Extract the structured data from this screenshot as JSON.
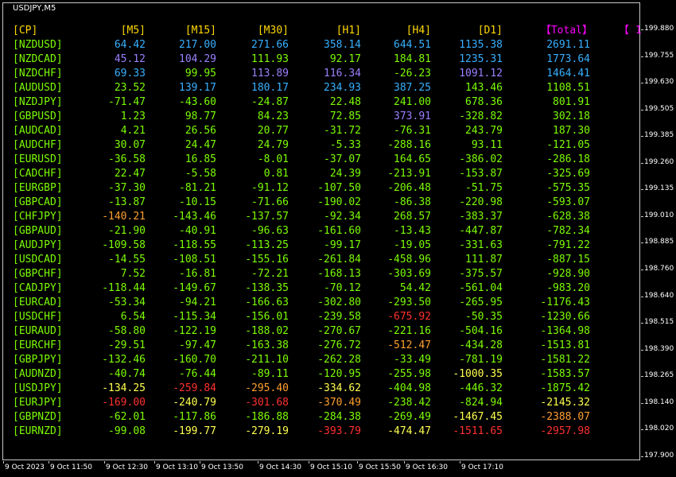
{
  "chart_title": "USDJPY,M5",
  "price_axis": [
    "199.880",
    "199.755",
    "199.630",
    "199.505",
    "199.385",
    "199.260",
    "199.135",
    "199.010",
    "198.885",
    "198.760",
    "198.640",
    "198.515",
    "198.390",
    "198.265",
    "198.140",
    "198.020",
    "197.900"
  ],
  "time_axis": [
    "9 Oct 2023",
    "9 Oct 11:50",
    "9 Oct 12:30",
    "9 Oct 13:10",
    "9 Oct 13:50",
    "9 Oct 14:30",
    "9 Oct 15:10",
    "9 Oct 15:50",
    "9 Oct 16:30",
    "9 Oct 17:10"
  ],
  "colors": {
    "header_tf": "#ffd700",
    "header_total": "#ff00ff",
    "pair": "#7cfc00",
    "neutral": "#7cfc00",
    "strong_blue": "#38b0ff",
    "strong_purple": "#9b80ff",
    "weak_orange": "#ff9f30",
    "weak_yellow": "#ffff50",
    "weak_red": "#ff3030"
  },
  "table": {
    "headers": [
      "[CP]",
      "[M5]",
      "[M15]",
      "[M30]",
      "[H1]",
      "[H4]",
      "[D1]",
      "【Total】",
      "【 1"
    ],
    "rows": [
      {
        "pair": "[NZDUSD]",
        "vals": [
          "64.42",
          "217.00",
          "271.66",
          "358.14",
          "644.51",
          "1135.38",
          "2691.11"
        ],
        "c": [
          "b",
          "b",
          "b",
          "b",
          "b",
          "b",
          "b"
        ]
      },
      {
        "pair": "[NZDCAD]",
        "vals": [
          "45.12",
          "104.29",
          "111.93",
          "92.17",
          "184.81",
          "1235.31",
          "1773.64"
        ],
        "c": [
          "p",
          "p",
          "n",
          "n",
          "n",
          "b",
          "b"
        ]
      },
      {
        "pair": "[NZDCHF]",
        "vals": [
          "69.33",
          "99.95",
          "113.89",
          "116.34",
          "-26.23",
          "1091.12",
          "1464.41"
        ],
        "c": [
          "b",
          "n",
          "p",
          "p",
          "n",
          "p",
          "b"
        ]
      },
      {
        "pair": "[AUDUSD]",
        "vals": [
          "23.52",
          "139.17",
          "180.17",
          "234.93",
          "387.25",
          "143.46",
          "1108.51"
        ],
        "c": [
          "n",
          "b",
          "b",
          "b",
          "b",
          "n",
          "n"
        ]
      },
      {
        "pair": "[NZDJPY]",
        "vals": [
          "-71.47",
          "-43.60",
          "-24.87",
          "22.48",
          "241.00",
          "678.36",
          "801.91"
        ],
        "c": [
          "n",
          "n",
          "n",
          "n",
          "n",
          "n",
          "n"
        ]
      },
      {
        "pair": "[GBPUSD]",
        "vals": [
          "1.23",
          "98.77",
          "84.23",
          "72.85",
          "373.91",
          "-328.82",
          "302.18"
        ],
        "c": [
          "n",
          "n",
          "n",
          "n",
          "p",
          "n",
          "n"
        ]
      },
      {
        "pair": "[AUDCAD]",
        "vals": [
          "4.21",
          "26.56",
          "20.77",
          "-31.72",
          "-76.31",
          "243.79",
          "187.30"
        ],
        "c": [
          "n",
          "n",
          "n",
          "n",
          "n",
          "n",
          "n"
        ]
      },
      {
        "pair": "[AUDCHF]",
        "vals": [
          "30.07",
          "24.47",
          "24.79",
          "-5.33",
          "-288.16",
          "93.11",
          "-121.05"
        ],
        "c": [
          "n",
          "n",
          "n",
          "n",
          "n",
          "n",
          "n"
        ]
      },
      {
        "pair": "[EURUSD]",
        "vals": [
          "-36.58",
          "16.85",
          "-8.01",
          "-37.07",
          "164.65",
          "-386.02",
          "-286.18"
        ],
        "c": [
          "n",
          "n",
          "n",
          "n",
          "n",
          "n",
          "n"
        ]
      },
      {
        "pair": "[CADCHF]",
        "vals": [
          "22.47",
          "-5.58",
          "0.81",
          "24.39",
          "-213.91",
          "-153.87",
          "-325.69"
        ],
        "c": [
          "n",
          "n",
          "n",
          "n",
          "n",
          "n",
          "n"
        ]
      },
      {
        "pair": "[EURGBP]",
        "vals": [
          "-37.30",
          "-81.21",
          "-91.12",
          "-107.50",
          "-206.48",
          "-51.75",
          "-575.35"
        ],
        "c": [
          "n",
          "n",
          "n",
          "n",
          "n",
          "n",
          "n"
        ]
      },
      {
        "pair": "[GBPCAD]",
        "vals": [
          "-13.87",
          "-10.15",
          "-71.66",
          "-190.02",
          "-86.38",
          "-220.98",
          "-593.07"
        ],
        "c": [
          "n",
          "n",
          "n",
          "n",
          "n",
          "n",
          "n"
        ]
      },
      {
        "pair": "[CHFJPY]",
        "vals": [
          "-140.21",
          "-143.46",
          "-137.57",
          "-92.34",
          "268.57",
          "-383.37",
          "-628.38"
        ],
        "c": [
          "o",
          "n",
          "n",
          "n",
          "n",
          "n",
          "n"
        ]
      },
      {
        "pair": "[GBPAUD]",
        "vals": [
          "-21.90",
          "-40.91",
          "-96.63",
          "-161.60",
          "-13.43",
          "-447.87",
          "-782.34"
        ],
        "c": [
          "n",
          "n",
          "n",
          "n",
          "n",
          "n",
          "n"
        ]
      },
      {
        "pair": "[AUDJPY]",
        "vals": [
          "-109.58",
          "-118.55",
          "-113.25",
          "-99.17",
          "-19.05",
          "-331.63",
          "-791.22"
        ],
        "c": [
          "n",
          "n",
          "n",
          "n",
          "n",
          "n",
          "n"
        ]
      },
      {
        "pair": "[USDCAD]",
        "vals": [
          "-14.55",
          "-108.51",
          "-155.16",
          "-261.84",
          "-458.96",
          "111.87",
          "-887.15"
        ],
        "c": [
          "n",
          "n",
          "n",
          "n",
          "n",
          "n",
          "n"
        ]
      },
      {
        "pair": "[GBPCHF]",
        "vals": [
          "7.52",
          "-16.81",
          "-72.21",
          "-168.13",
          "-303.69",
          "-375.57",
          "-928.90"
        ],
        "c": [
          "n",
          "n",
          "n",
          "n",
          "n",
          "n",
          "n"
        ]
      },
      {
        "pair": "[CADJPY]",
        "vals": [
          "-118.44",
          "-149.67",
          "-138.35",
          "-70.12",
          "54.42",
          "-561.04",
          "-983.20"
        ],
        "c": [
          "n",
          "n",
          "n",
          "n",
          "n",
          "n",
          "n"
        ]
      },
      {
        "pair": "[EURCAD]",
        "vals": [
          "-53.34",
          "-94.21",
          "-166.63",
          "-302.80",
          "-293.50",
          "-265.95",
          "-1176.43"
        ],
        "c": [
          "n",
          "n",
          "n",
          "n",
          "n",
          "n",
          "n"
        ]
      },
      {
        "pair": "[USDCHF]",
        "vals": [
          "6.54",
          "-115.34",
          "-156.01",
          "-239.58",
          "-675.92",
          "-50.35",
          "-1230.66"
        ],
        "c": [
          "n",
          "n",
          "n",
          "n",
          "r",
          "n",
          "n"
        ]
      },
      {
        "pair": "[EURAUD]",
        "vals": [
          "-58.80",
          "-122.19",
          "-188.02",
          "-270.67",
          "-221.16",
          "-504.16",
          "-1364.98"
        ],
        "c": [
          "n",
          "n",
          "n",
          "n",
          "n",
          "n",
          "n"
        ]
      },
      {
        "pair": "[EURCHF]",
        "vals": [
          "-29.51",
          "-97.47",
          "-163.38",
          "-276.72",
          "-512.47",
          "-434.28",
          "-1513.81"
        ],
        "c": [
          "n",
          "n",
          "n",
          "n",
          "o",
          "n",
          "n"
        ]
      },
      {
        "pair": "[GBPJPY]",
        "vals": [
          "-132.46",
          "-160.70",
          "-211.10",
          "-262.28",
          "-33.49",
          "-781.19",
          "-1581.22"
        ],
        "c": [
          "n",
          "n",
          "n",
          "n",
          "n",
          "n",
          "n"
        ]
      },
      {
        "pair": "[AUDNZD]",
        "vals": [
          "-40.74",
          "-76.44",
          "-89.11",
          "-120.95",
          "-255.98",
          "-1000.35",
          "-1583.57"
        ],
        "c": [
          "n",
          "n",
          "n",
          "n",
          "n",
          "y",
          "n"
        ]
      },
      {
        "pair": "[USDJPY]",
        "vals": [
          "-134.25",
          "-259.84",
          "-295.40",
          "-334.62",
          "-404.98",
          "-446.32",
          "-1875.42"
        ],
        "c": [
          "y",
          "r",
          "o",
          "y",
          "n",
          "n",
          "n"
        ]
      },
      {
        "pair": "[EURJPY]",
        "vals": [
          "-169.00",
          "-240.79",
          "-301.68",
          "-370.49",
          "-238.42",
          "-824.94",
          "-2145.32"
        ],
        "c": [
          "r",
          "y",
          "r",
          "o",
          "n",
          "n",
          "y"
        ]
      },
      {
        "pair": "[GBPNZD]",
        "vals": [
          "-62.01",
          "-117.86",
          "-186.88",
          "-284.38",
          "-269.49",
          "-1467.45",
          "-2388.07"
        ],
        "c": [
          "n",
          "n",
          "n",
          "n",
          "n",
          "y",
          "o"
        ]
      },
      {
        "pair": "[EURNZD]",
        "vals": [
          "-99.08",
          "-199.77",
          "-279.19",
          "-393.79",
          "-474.47",
          "-1511.65",
          "-2957.98"
        ],
        "c": [
          "n",
          "y",
          "y",
          "r",
          "y",
          "r",
          "r"
        ]
      }
    ]
  }
}
